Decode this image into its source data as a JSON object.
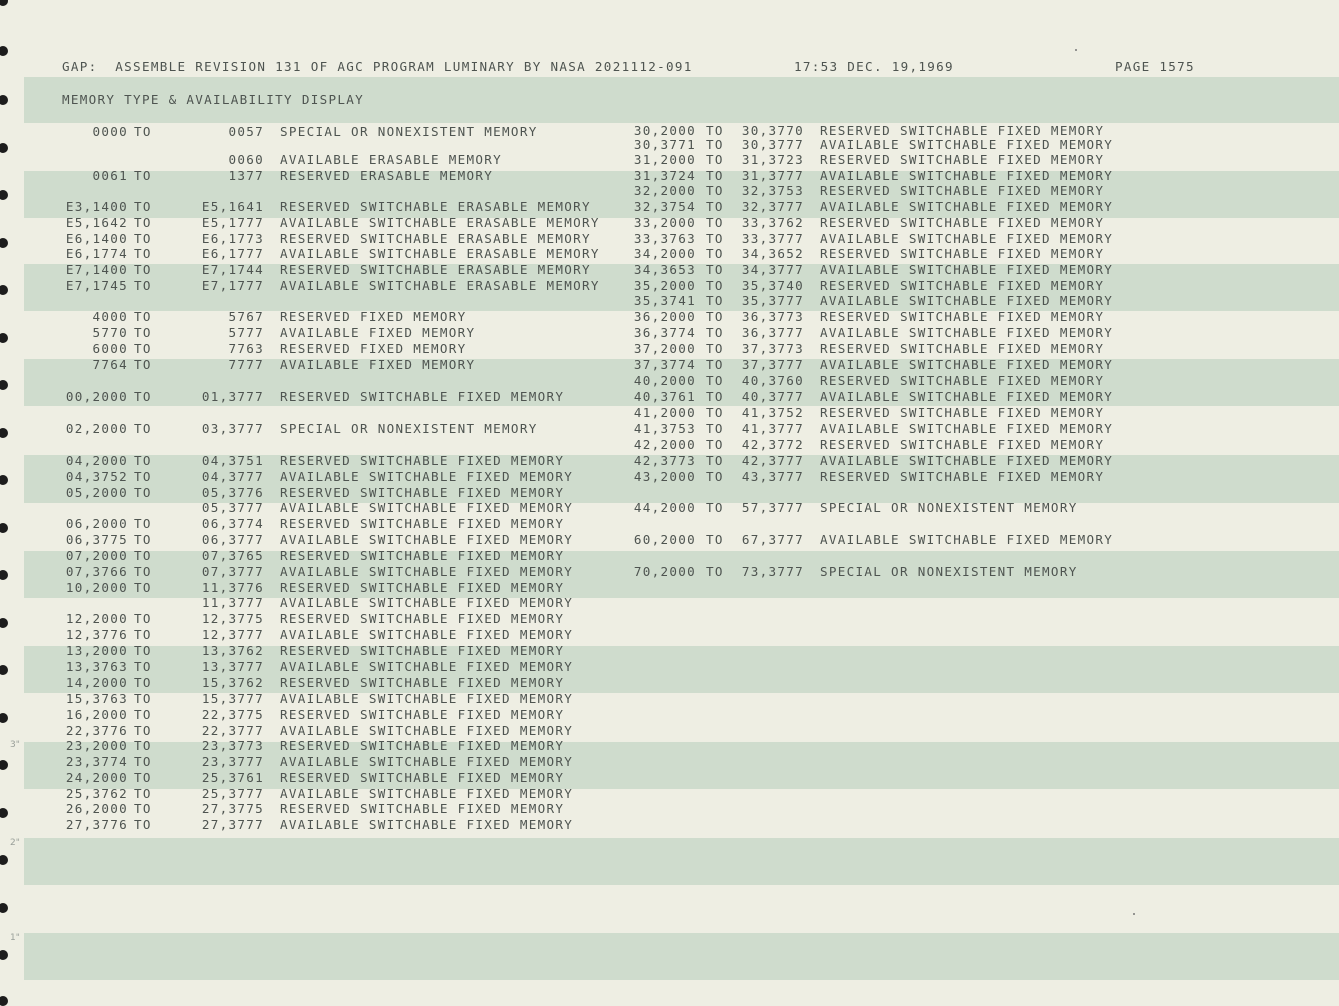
{
  "header": {
    "program_line": "GAP:  ASSEMBLE REVISION 131 OF AGC PROGRAM LUMINARY BY NASA 2021112-091",
    "time": "17:53 DEC. 19,1969",
    "page": "PAGE 1575"
  },
  "section_title": "MEMORY TYPE & AVAILABILITY DISPLAY",
  "margin_marks": [
    "3\"",
    "2\"",
    "1\""
  ],
  "left_entries": [
    {
      "start": "0000",
      "to": "TO",
      "end": "0057",
      "desc": "SPECIAL OR NONEXISTENT MEMORY"
    },
    {
      "start": "",
      "to": "",
      "end": "0060",
      "desc": "AVAILABLE ERASABLE MEMORY"
    },
    {
      "start": "0061",
      "to": "TO",
      "end": "1377",
      "desc": "RESERVED ERASABLE MEMORY"
    },
    {
      "start": "E3,1400",
      "to": "TO",
      "end": "E5,1641",
      "desc": "RESERVED SWITCHABLE ERASABLE MEMORY"
    },
    {
      "start": "E5,1642",
      "to": "TO",
      "end": "E5,1777",
      "desc": "AVAILABLE SWITCHABLE ERASABLE MEMORY"
    },
    {
      "start": "E6,1400",
      "to": "TO",
      "end": "E6,1773",
      "desc": "RESERVED SWITCHABLE ERASABLE MEMORY"
    },
    {
      "start": "E6,1774",
      "to": "TO",
      "end": "E6,1777",
      "desc": "AVAILABLE SWITCHABLE ERASABLE MEMORY"
    },
    {
      "start": "E7,1400",
      "to": "TO",
      "end": "E7,1744",
      "desc": "RESERVED SWITCHABLE ERASABLE MEMORY"
    },
    {
      "start": "E7,1745",
      "to": "TO",
      "end": "E7,1777",
      "desc": "AVAILABLE SWITCHABLE ERASABLE MEMORY"
    },
    {
      "start": "4000",
      "to": "TO",
      "end": "5767",
      "desc": "RESERVED FIXED MEMORY"
    },
    {
      "start": "5770",
      "to": "TO",
      "end": "5777",
      "desc": "AVAILABLE FIXED MEMORY"
    },
    {
      "start": "6000",
      "to": "TO",
      "end": "7763",
      "desc": "RESERVED FIXED MEMORY"
    },
    {
      "start": "7764",
      "to": "TO",
      "end": "7777",
      "desc": "AVAILABLE FIXED MEMORY"
    },
    {
      "start": "00,2000",
      "to": "TO",
      "end": "01,3777",
      "desc": "RESERVED SWITCHABLE FIXED MEMORY"
    },
    {
      "start": "02,2000",
      "to": "TO",
      "end": "03,3777",
      "desc": "SPECIAL OR NONEXISTENT MEMORY"
    },
    {
      "start": "04,2000",
      "to": "TO",
      "end": "04,3751",
      "desc": "RESERVED SWITCHABLE FIXED MEMORY"
    },
    {
      "start": "04,3752",
      "to": "TO",
      "end": "04,3777",
      "desc": "AVAILABLE SWITCHABLE FIXED MEMORY"
    },
    {
      "start": "05,2000",
      "to": "TO",
      "end": "05,3776",
      "desc": "RESERVED SWITCHABLE FIXED MEMORY"
    },
    {
      "start": "",
      "to": "",
      "end": "05,3777",
      "desc": "AVAILABLE SWITCHABLE FIXED MEMORY"
    },
    {
      "start": "06,2000",
      "to": "TO",
      "end": "06,3774",
      "desc": "RESERVED SWITCHABLE FIXED MEMORY"
    },
    {
      "start": "06,3775",
      "to": "TO",
      "end": "06,3777",
      "desc": "AVAILABLE SWITCHABLE FIXED MEMORY"
    },
    {
      "start": "07,2000",
      "to": "TO",
      "end": "07,3765",
      "desc": "RESERVED SWITCHABLE FIXED MEMORY"
    },
    {
      "start": "07,3766",
      "to": "TO",
      "end": "07,3777",
      "desc": "AVAILABLE SWITCHABLE FIXED MEMORY"
    },
    {
      "start": "10,2000",
      "to": "TO",
      "end": "11,3776",
      "desc": "RESERVED SWITCHABLE FIXED MEMORY"
    },
    {
      "start": "",
      "to": "",
      "end": "11,3777",
      "desc": "AVAILABLE SWITCHABLE FIXED MEMORY"
    },
    {
      "start": "12,2000",
      "to": "TO",
      "end": "12,3775",
      "desc": "RESERVED SWITCHABLE FIXED MEMORY"
    },
    {
      "start": "12,3776",
      "to": "TO",
      "end": "12,3777",
      "desc": "AVAILABLE SWITCHABLE FIXED MEMORY"
    },
    {
      "start": "13,2000",
      "to": "TO",
      "end": "13,3762",
      "desc": "RESERVED SWITCHABLE FIXED MEMORY"
    },
    {
      "start": "13,3763",
      "to": "TO",
      "end": "13,3777",
      "desc": "AVAILABLE SWITCHABLE FIXED MEMORY"
    },
    {
      "start": "14,2000",
      "to": "TO",
      "end": "15,3762",
      "desc": "RESERVED SWITCHABLE FIXED MEMORY"
    },
    {
      "start": "15,3763",
      "to": "TO",
      "end": "15,3777",
      "desc": "AVAILABLE SWITCHABLE FIXED MEMORY"
    },
    {
      "start": "16,2000",
      "to": "TO",
      "end": "22,3775",
      "desc": "RESERVED SWITCHABLE FIXED MEMORY"
    },
    {
      "start": "22,3776",
      "to": "TO",
      "end": "22,3777",
      "desc": "AVAILABLE SWITCHABLE FIXED MEMORY"
    },
    {
      "start": "23,2000",
      "to": "TO",
      "end": "23,3773",
      "desc": "RESERVED SWITCHABLE FIXED MEMORY"
    },
    {
      "start": "23,3774",
      "to": "TO",
      "end": "23,3777",
      "desc": "AVAILABLE SWITCHABLE FIXED MEMORY"
    },
    {
      "start": "24,2000",
      "to": "TO",
      "end": "25,3761",
      "desc": "RESERVED SWITCHABLE FIXED MEMORY"
    },
    {
      "start": "25,3762",
      "to": "TO",
      "end": "25,3777",
      "desc": "AVAILABLE SWITCHABLE FIXED MEMORY"
    },
    {
      "start": "26,2000",
      "to": "TO",
      "end": "27,3775",
      "desc": "RESERVED SWITCHABLE FIXED MEMORY"
    },
    {
      "start": "27,3776",
      "to": "TO",
      "end": "27,3777",
      "desc": "AVAILABLE SWITCHABLE FIXED MEMORY"
    }
  ],
  "right_entries": [
    {
      "start": "30,2000",
      "to": "TO",
      "end": "30,3770",
      "desc": "RESERVED SWITCHABLE FIXED MEMORY"
    },
    {
      "start": "30,3771",
      "to": "TO",
      "end": "30,3777",
      "desc": "AVAILABLE SWITCHABLE FIXED MEMORY"
    },
    {
      "start": "31,2000",
      "to": "TO",
      "end": "31,3723",
      "desc": "RESERVED SWITCHABLE FIXED MEMORY"
    },
    {
      "start": "31,3724",
      "to": "TO",
      "end": "31,3777",
      "desc": "AVAILABLE SWITCHABLE FIXED MEMORY"
    },
    {
      "start": "32,2000",
      "to": "TO",
      "end": "32,3753",
      "desc": "RESERVED SWITCHABLE FIXED MEMORY"
    },
    {
      "start": "32,3754",
      "to": "TO",
      "end": "32,3777",
      "desc": "AVAILABLE SWITCHABLE FIXED MEMORY"
    },
    {
      "start": "33,2000",
      "to": "TO",
      "end": "33,3762",
      "desc": "RESERVED SWITCHABLE FIXED MEMORY"
    },
    {
      "start": "33,3763",
      "to": "TO",
      "end": "33,3777",
      "desc": "AVAILABLE SWITCHABLE FIXED MEMORY"
    },
    {
      "start": "34,2000",
      "to": "TO",
      "end": "34,3652",
      "desc": "RESERVED SWITCHABLE FIXED MEMORY"
    },
    {
      "start": "34,3653",
      "to": "TO",
      "end": "34,3777",
      "desc": "AVAILABLE SWITCHABLE FIXED MEMORY"
    },
    {
      "start": "35,2000",
      "to": "TO",
      "end": "35,3740",
      "desc": "RESERVED SWITCHABLE FIXED MEMORY"
    },
    {
      "start": "35,3741",
      "to": "TO",
      "end": "35,3777",
      "desc": "AVAILABLE SWITCHABLE FIXED MEMORY"
    },
    {
      "start": "36,2000",
      "to": "TO",
      "end": "36,3773",
      "desc": "RESERVED SWITCHABLE FIXED MEMORY"
    },
    {
      "start": "36,3774",
      "to": "TO",
      "end": "36,3777",
      "desc": "AVAILABLE SWITCHABLE FIXED MEMORY"
    },
    {
      "start": "37,2000",
      "to": "TO",
      "end": "37,3773",
      "desc": "RESERVED SWITCHABLE FIXED MEMORY"
    },
    {
      "start": "37,3774",
      "to": "TO",
      "end": "37,3777",
      "desc": "AVAILABLE SWITCHABLE FIXED MEMORY"
    },
    {
      "start": "40,2000",
      "to": "TO",
      "end": "40,3760",
      "desc": "RESERVED SWITCHABLE FIXED MEMORY"
    },
    {
      "start": "40,3761",
      "to": "TO",
      "end": "40,3777",
      "desc": "AVAILABLE SWITCHABLE FIXED MEMORY"
    },
    {
      "start": "41,2000",
      "to": "TO",
      "end": "41,3752",
      "desc": "RESERVED SWITCHABLE FIXED MEMORY"
    },
    {
      "start": "41,3753",
      "to": "TO",
      "end": "41,3777",
      "desc": "AVAILABLE SWITCHABLE FIXED MEMORY"
    },
    {
      "start": "42,2000",
      "to": "TO",
      "end": "42,3772",
      "desc": "RESERVED SWITCHABLE FIXED MEMORY"
    },
    {
      "start": "42,3773",
      "to": "TO",
      "end": "42,3777",
      "desc": "AVAILABLE SWITCHABLE FIXED MEMORY"
    },
    {
      "start": "43,2000",
      "to": "TO",
      "end": "43,3777",
      "desc": "RESERVED SWITCHABLE FIXED MEMORY"
    },
    {
      "start": "44,2000",
      "to": "TO",
      "end": "57,3777",
      "desc": "SPECIAL OR NONEXISTENT MEMORY"
    },
    {
      "start": "60,2000",
      "to": "TO",
      "end": "67,3777",
      "desc": "AVAILABLE SWITCHABLE FIXED MEMORY"
    },
    {
      "start": "70,2000",
      "to": "TO",
      "end": "73,3777",
      "desc": "SPECIAL OR NONEXISTENT MEMORY"
    }
  ]
}
